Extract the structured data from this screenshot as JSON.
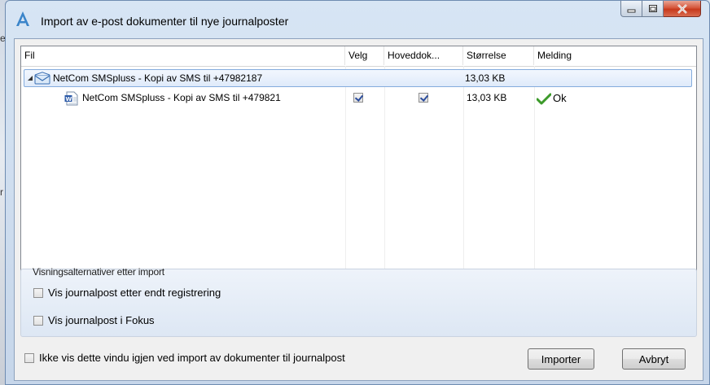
{
  "background": {
    "fragments": [
      "e",
      "r"
    ]
  },
  "window": {
    "title": "Import av e-post dokumenter til nye journalposter",
    "buttons": {
      "minimize": "minimize",
      "maximize": "maximize",
      "close": "close"
    }
  },
  "grid": {
    "columns": [
      "Fil",
      "Velg",
      "Hoveddok...",
      "Størrelse",
      "Melding"
    ],
    "rows": [
      {
        "type": "email",
        "name": "NetCom SMSpluss - Kopi av SMS til +47982187",
        "size": "13,03 KB",
        "expanded": true
      },
      {
        "type": "word-document",
        "name": "NetCom SMSpluss - Kopi av SMS til +479821",
        "velg": true,
        "hoveddokument": true,
        "size": "13,03 KB",
        "melding": "Ok"
      }
    ]
  },
  "options": {
    "legend": "Visningsalternativer etter import",
    "items": [
      {
        "label": "Vis journalpost etter endt registrering",
        "checked": false
      },
      {
        "label": "Vis journalpost i Fokus",
        "checked": false
      }
    ]
  },
  "footer": {
    "dont_show_label": "Ikke vis dette vindu igjen ved import av dokumenter til journalpost",
    "dont_show_checked": false,
    "import_button": "Importer",
    "cancel_button": "Avbryt"
  },
  "colors": {
    "accent": "#3a84c9",
    "ok_check": "#3c9a2a",
    "close": "#c7391c"
  }
}
